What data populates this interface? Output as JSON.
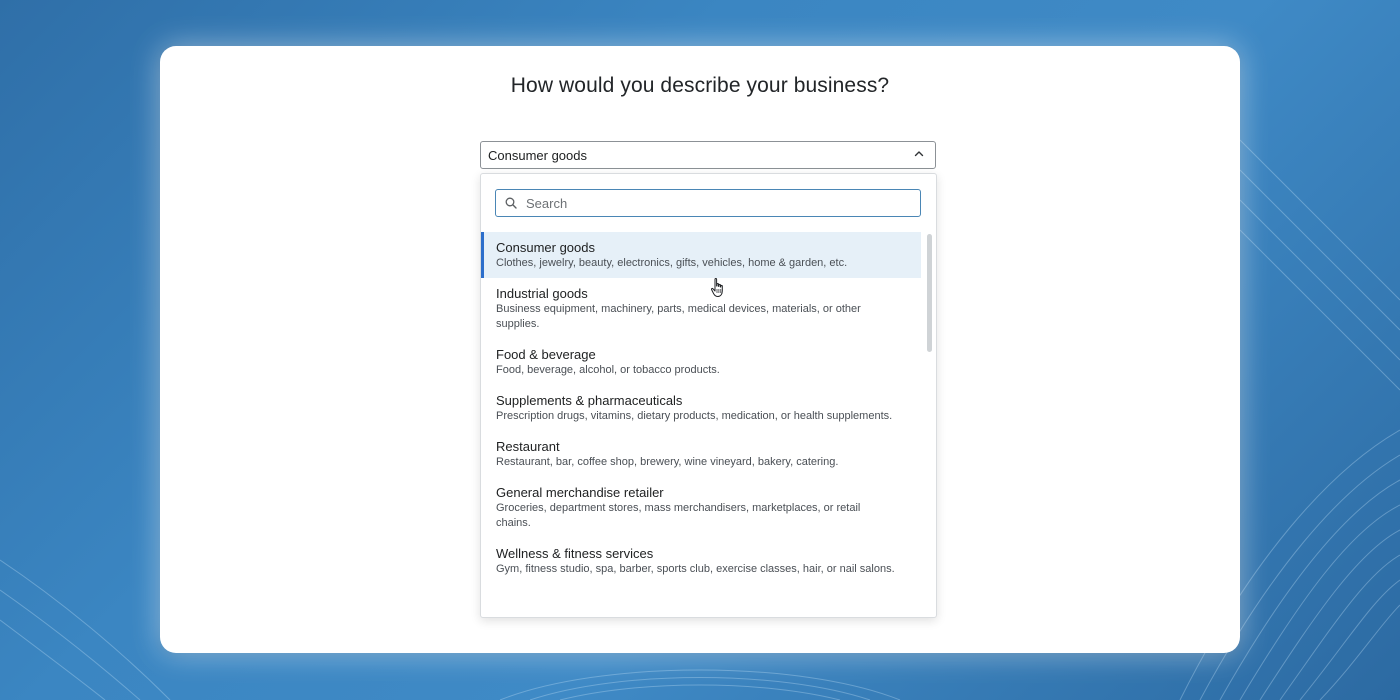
{
  "page": {
    "title": "How would you describe your business?"
  },
  "select": {
    "value": "Consumer goods",
    "chevron_icon": "chevron-up-icon"
  },
  "search": {
    "placeholder": "Search",
    "icon": "search-icon"
  },
  "options": [
    {
      "title": "Consumer goods",
      "description": "Clothes, jewelry, beauty, electronics, gifts, vehicles, home & garden, etc.",
      "selected": true
    },
    {
      "title": "Industrial goods",
      "description": "Business equipment, machinery, parts, medical devices, materials, or other supplies."
    },
    {
      "title": "Food & beverage",
      "description": "Food, beverage, alcohol, or tobacco products."
    },
    {
      "title": "Supplements & pharmaceuticals",
      "description": "Prescription drugs, vitamins, dietary products, medication, or health supplements."
    },
    {
      "title": "Restaurant",
      "description": "Restaurant, bar, coffee shop, brewery, wine vineyard, bakery, catering."
    },
    {
      "title": "General merchandise retailer",
      "description": "Groceries, department stores, mass merchandisers, marketplaces, or retail chains."
    },
    {
      "title": "Wellness & fitness services",
      "description": "Gym, fitness studio, spa, barber, sports club, exercise classes, hair, or nail salons."
    }
  ],
  "colors": {
    "accent": "#2c6ecb",
    "selected_bg": "#e6f0f8",
    "background": "#3b86c2"
  }
}
